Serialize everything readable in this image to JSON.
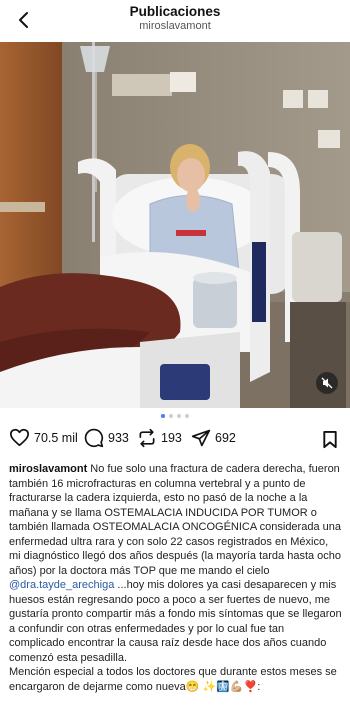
{
  "header": {
    "title": "Publicaciones",
    "username": "miroslavamont"
  },
  "carousel": {
    "total": 4,
    "active": 1
  },
  "actions": {
    "likes": "70.5 mil",
    "comments": "933",
    "reposts": "193",
    "shares": "692"
  },
  "caption": {
    "username": "miroslavamont",
    "text_1": " No fue solo una fractura de cadera derecha, fueron también 16 microfracturas en columna vertebral y a punto de fracturarse la cadera izquierda, esto no pasó de la noche a la mañana y se llama OSTEMALACIA INDUCIDA POR TUMOR o también llamada OSTEOMALACIA ONCOGÉNICA considerada una enfermedad ultra rara y con solo 22 casos registrados en México, mi diagnóstico llegó dos años después (la mayoría tarda hasta ocho años) por la doctora más TOP que me mando el cielo ",
    "mention": "@dra.tayde_arechiga",
    "text_2": " ...hoy mis dolores ya casi desaparecen y mis huesos están regresando poco a poco a ser fuertes de nuevo, me gustaría pronto compartir más a fondo mis síntomas que se llegaron a confundir con otras enfermedades y por lo cual fue tan complicado encontrar la causa raíz desde hace dos años cuando comenzó esta pesadilla.",
    "paragraph_2": "Mención especial a todos los doctores que durante estos meses se encargaron de dejarme como nueva😁 ✨🩻💪🏼❣️:"
  },
  "icons": {
    "back": "chevron-left-icon",
    "like": "heart-icon",
    "comment": "comment-bubble-icon",
    "repost": "repost-icon",
    "share": "send-icon",
    "save": "bookmark-icon",
    "mute": "speaker-muted-icon"
  },
  "colors": {
    "mention": "#2b59a3",
    "dot_active": "#3b82f6",
    "dot_inactive": "#cfcfcf"
  }
}
